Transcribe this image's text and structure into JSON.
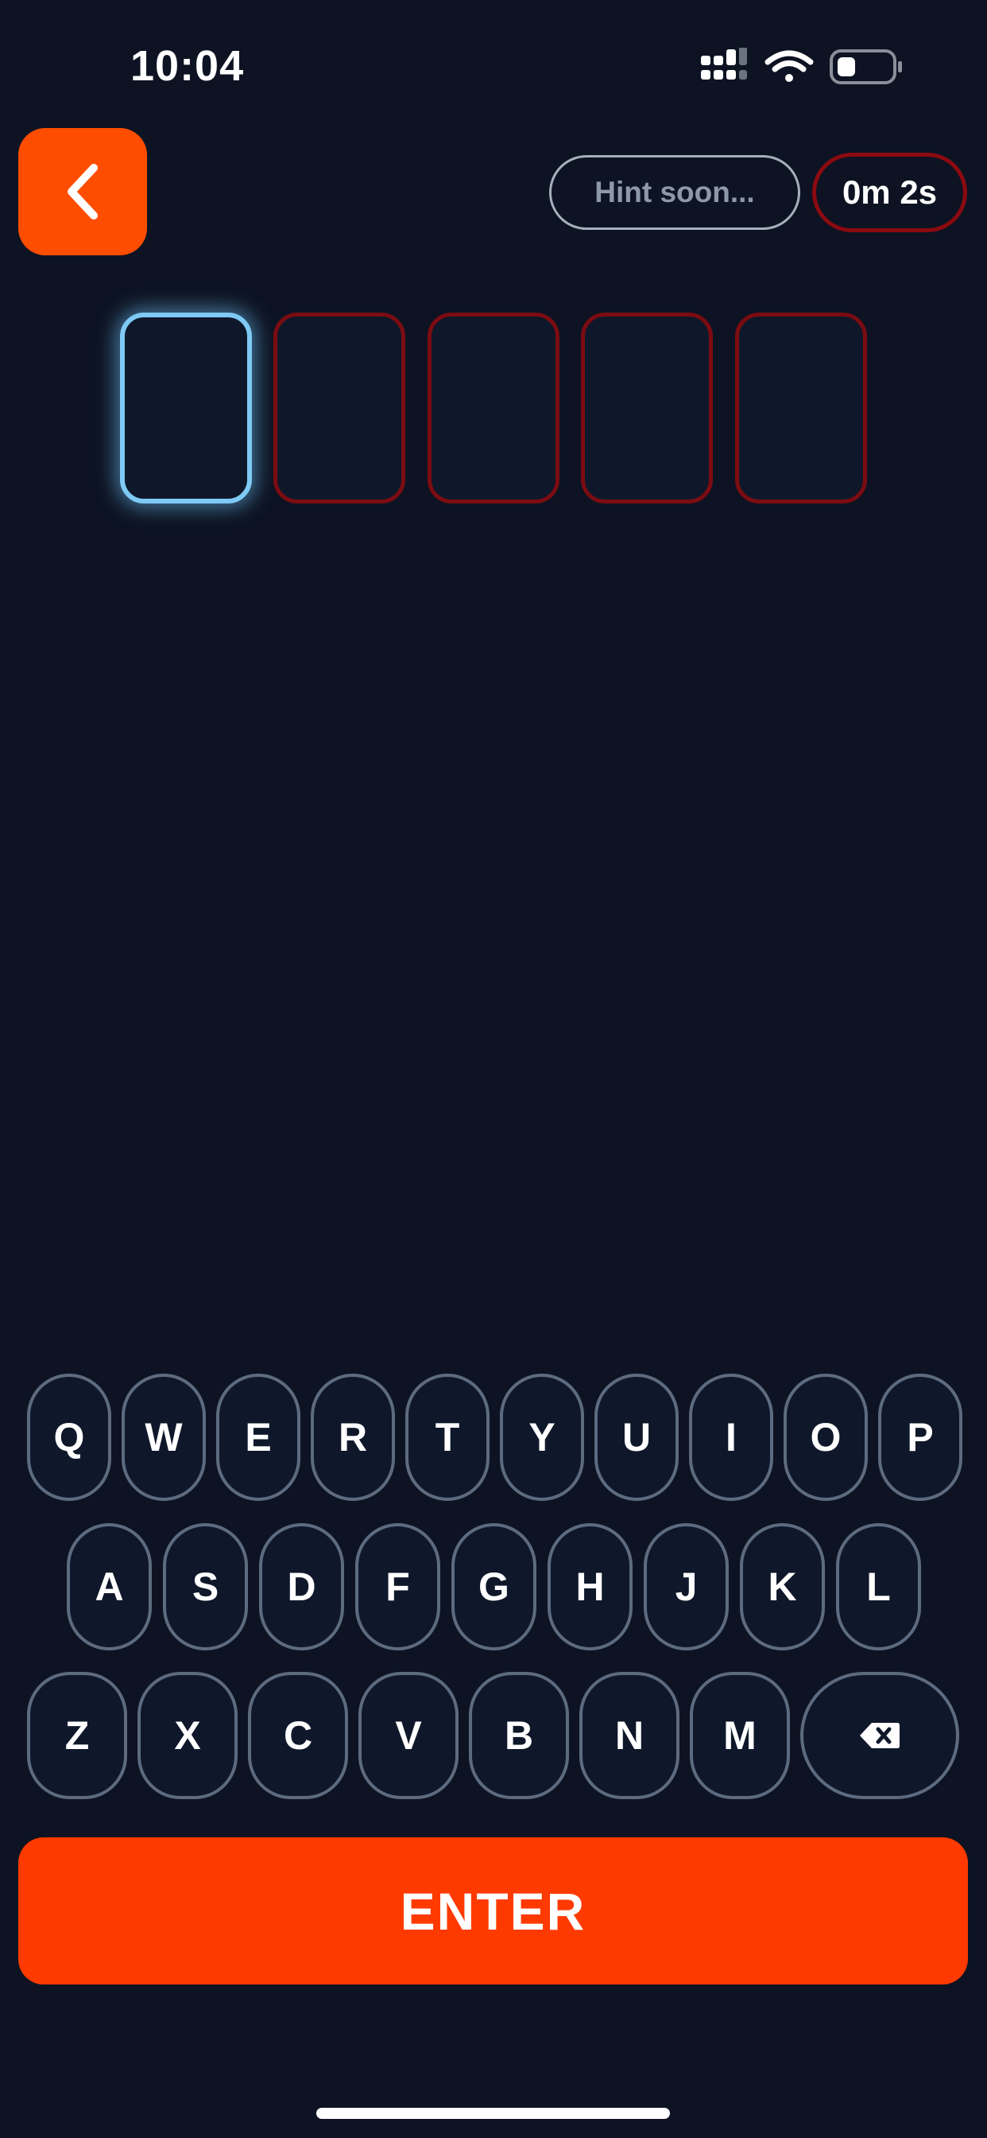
{
  "status_bar": {
    "time": "10:04",
    "icons": [
      "cellular-signal-icon",
      "wifi-icon",
      "battery-icon"
    ]
  },
  "header": {
    "back_icon": "chevron-left-icon",
    "hint_label": "Hint soon...",
    "timer": "0m 2s"
  },
  "slots": {
    "count": 5,
    "letters": [
      "",
      "",
      "",
      "",
      ""
    ],
    "active_index": 0
  },
  "keyboard": {
    "row1": [
      "Q",
      "W",
      "E",
      "R",
      "T",
      "Y",
      "U",
      "I",
      "O",
      "P"
    ],
    "row2": [
      "A",
      "S",
      "D",
      "F",
      "G",
      "H",
      "J",
      "K",
      "L"
    ],
    "row3": [
      "Z",
      "X",
      "C",
      "V",
      "B",
      "N",
      "M"
    ],
    "backspace_icon": "backspace-icon"
  },
  "enter_label": "ENTER",
  "colors": {
    "background": "#0d1322",
    "accent": "#ff3a00",
    "slot_border": "#7a0c12",
    "active_slot": "#7ec9f5",
    "key_border": "#5d6b80"
  }
}
